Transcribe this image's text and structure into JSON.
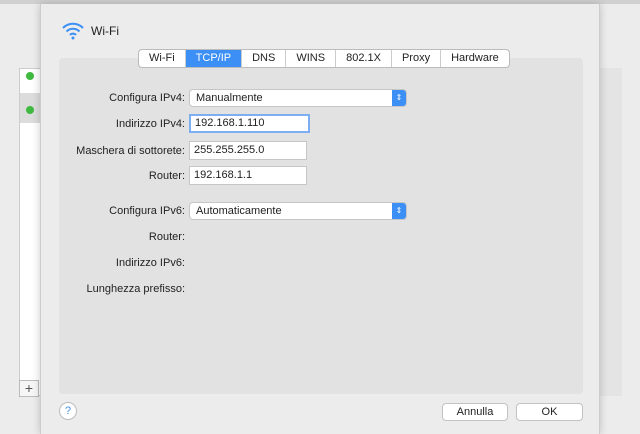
{
  "window": {
    "title": "Wi-Fi",
    "icon": "wifi-icon"
  },
  "tabs": [
    "Wi-Fi",
    "TCP/IP",
    "DNS",
    "WINS",
    "802.1X",
    "Proxy",
    "Hardware"
  ],
  "active_tab": "TCP/IP",
  "ipv4": {
    "configure_label": "Configura IPv4:",
    "configure_value": "Manualmente",
    "address_label": "Indirizzo IPv4:",
    "address_value": "192.168.1.110",
    "mask_label": "Maschera di sottorete:",
    "mask_value": "255.255.255.0",
    "router_label": "Router:",
    "router_value": "192.168.1.1"
  },
  "ipv6": {
    "configure_label": "Configura IPv6:",
    "configure_value": "Automaticamente",
    "router_label": "Router:",
    "address_label": "Indirizzo IPv6:",
    "prefix_label": "Lunghezza prefisso:"
  },
  "buttons": {
    "help": "?",
    "cancel": "Annulla",
    "ok": "OK",
    "add": "+"
  },
  "colors": {
    "accent": "#3b8ff5",
    "status_green": "#3fb93f"
  }
}
